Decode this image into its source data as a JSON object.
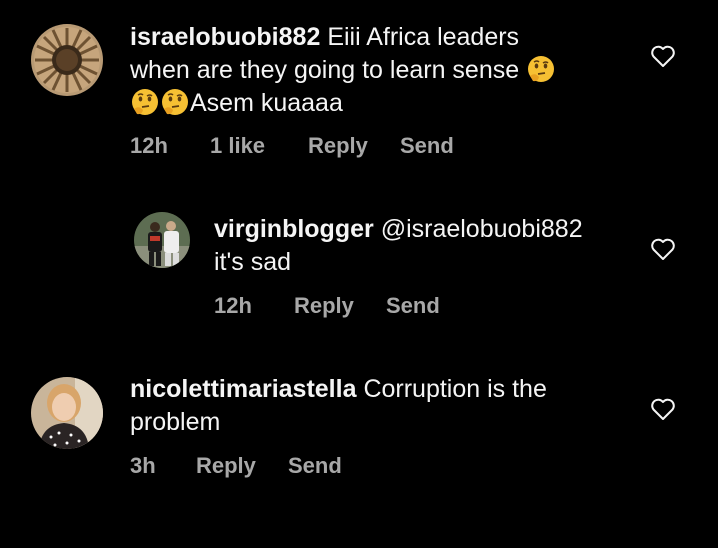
{
  "comments": [
    {
      "username": "israelobuobi882",
      "text_line1": "Eiii Africa leaders",
      "text_line2": "when are they going to learn sense",
      "text_line3": "Asem kuaaaa",
      "emoji": "thinking-face",
      "time": "12h",
      "likes": "1 like",
      "reply_label": "Reply",
      "send_label": "Send"
    },
    {
      "username": "virginblogger",
      "mention": "@israelobuobi882",
      "text_line2": "it's sad",
      "time": "12h",
      "reply_label": "Reply",
      "send_label": "Send"
    },
    {
      "username": "nicolettimariastella",
      "text_line1": "Corruption is the",
      "text_line2": "problem",
      "time": "3h",
      "reply_label": "Reply",
      "send_label": "Send"
    }
  ],
  "icons": {
    "like": "heart-outline-icon",
    "emoji": "thinking-face-emoji"
  },
  "colors": {
    "background": "#000000",
    "text": "#f5f5f5",
    "meta": "#a8a8a8",
    "emoji": "#f6c033"
  }
}
